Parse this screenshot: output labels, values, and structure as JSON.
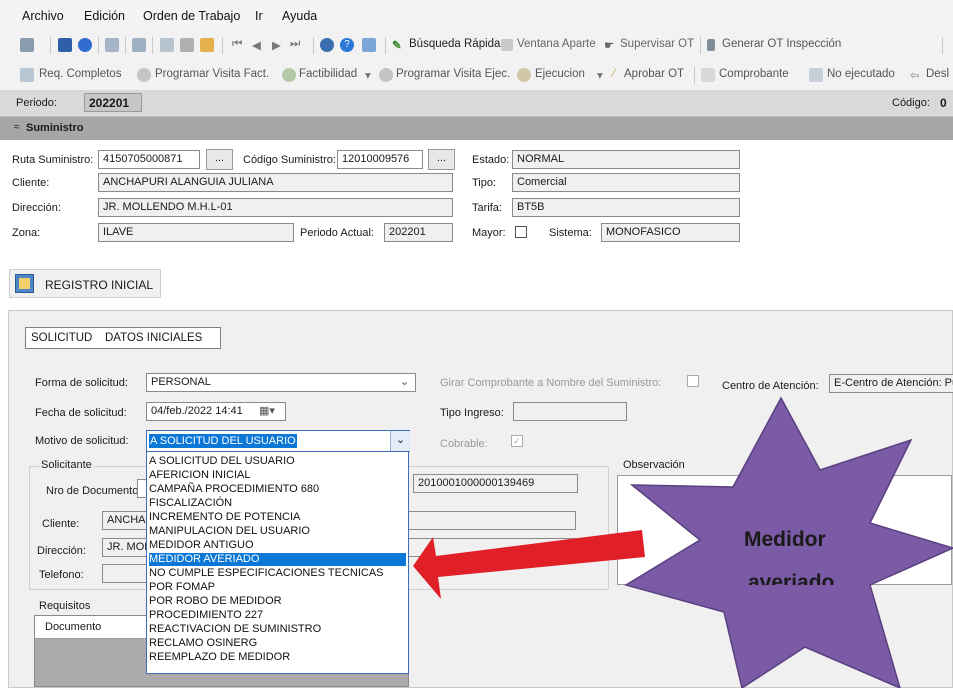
{
  "menu": [
    "Archivo",
    "Edición",
    "Orden de Trabajo",
    "Ir",
    "Ayuda"
  ],
  "toolbar1": {
    "busqueda": "Búsqueda Rápida",
    "ventana": "Ventana Aparte",
    "supervisar": "Supervisar OT",
    "generar": "Generar OT Inspección"
  },
  "toolbar2": {
    "req": "Req. Completos",
    "prog_fact": "Programar Visita Fact.",
    "factibilidad": "Factibilidad",
    "prog_ejec": "Programar Visita Ejec.",
    "ejecucion": "Ejecucion",
    "aprobar": "Aprobar OT",
    "comprobante": "Comprobante",
    "no_ejecutado": "No ejecutado",
    "des": "Desl"
  },
  "period": {
    "label": "Periodo:",
    "value": "202201",
    "codigo_label": "Código:",
    "codigo_value": "0"
  },
  "suministro": {
    "header": "Suministro",
    "ruta_label": "Ruta Suministro:",
    "ruta_value": "4150705000871",
    "codigo_label": "Código Suministro:",
    "codigo_value": "12010009576",
    "estado_label": "Estado:",
    "estado_value": "NORMAL",
    "cliente_label": "Cliente:",
    "cliente_value": "ANCHAPURI ALANGUIA JULIANA",
    "tipo_label": "Tipo:",
    "tipo_value": "Comercial",
    "direccion_label": "Dirección:",
    "direccion_value": "JR. MOLLENDO M.H.L-01",
    "tarifa_label": "Tarifa:",
    "tarifa_value": "BT5B",
    "zona_label": "Zona:",
    "zona_value": "ILAVE",
    "periodo_actual_label": "Periodo Actual:",
    "periodo_actual_value": "202201",
    "mayor_label": "Mayor:",
    "sistema_label": "Sistema:",
    "sistema_value": "MONOFASICO",
    "ellipsis": "..."
  },
  "registro_inicial": "REGISTRO INICIAL",
  "tabs": [
    "SOLICITUD",
    "DATOS INICIALES"
  ],
  "form": {
    "forma_label": "Forma de solicitud:",
    "forma_value": "PERSONAL",
    "girar_label": "Girar Comprobante a Nombre del Suministro:",
    "centro_label": "Centro de Atención:",
    "centro_value": "E-Centro de Atención: Pu",
    "fecha_label": "Fecha de solicitud:",
    "fecha_value": "04/feb./2022 14:41",
    "tipo_ingreso_label": "Tipo Ingreso:",
    "motivo_label": "Motivo de solicitud:",
    "motivo_value": "A SOLICITUD DEL USUARIO",
    "cobrable_label": "Cobrable:",
    "solicitante_label": "Solicitante",
    "nro_doc_label": "Nro de Documento:",
    "doc_value": "2010001000000139469",
    "cliente_label": "Cliente:",
    "cliente_value": "ANCHAI",
    "direccion_label": "Dirección:",
    "direccion_value": "JR. MOL",
    "telefono_label": "Telefono:",
    "requisitos_label": "Requisitos",
    "documento_col": "Documento",
    "observacion_label": "Observación"
  },
  "dropdown_options": [
    "A SOLICITUD DEL USUARIO",
    "AFERICION INICIAL",
    "CAMPAÑA PROCEDIMIENTO 680",
    "FISCALIZACIÓN",
    "INCREMENTO DE POTENCIA",
    "MANIPULACION DEL USUARIO",
    "MEDIDOR ANTIGUO",
    "MEDIDOR AVERIADO",
    "NO CUMPLE ESPECIFICACIONES TECNICAS",
    "POR FOMAP",
    "POR ROBO DE MEDIDOR",
    "PROCEDIMIENTO 227",
    "REACTIVACION DE SUMINISTRO",
    "RECLAMO OSINERG",
    "REEMPLAZO DE MEDIDOR"
  ],
  "dropdown_selected_index": 7,
  "annotation": {
    "line1": "Medidor",
    "line2": "averiado",
    "star_color": "#7b5aa6",
    "arrow_color": "#e11f26"
  }
}
